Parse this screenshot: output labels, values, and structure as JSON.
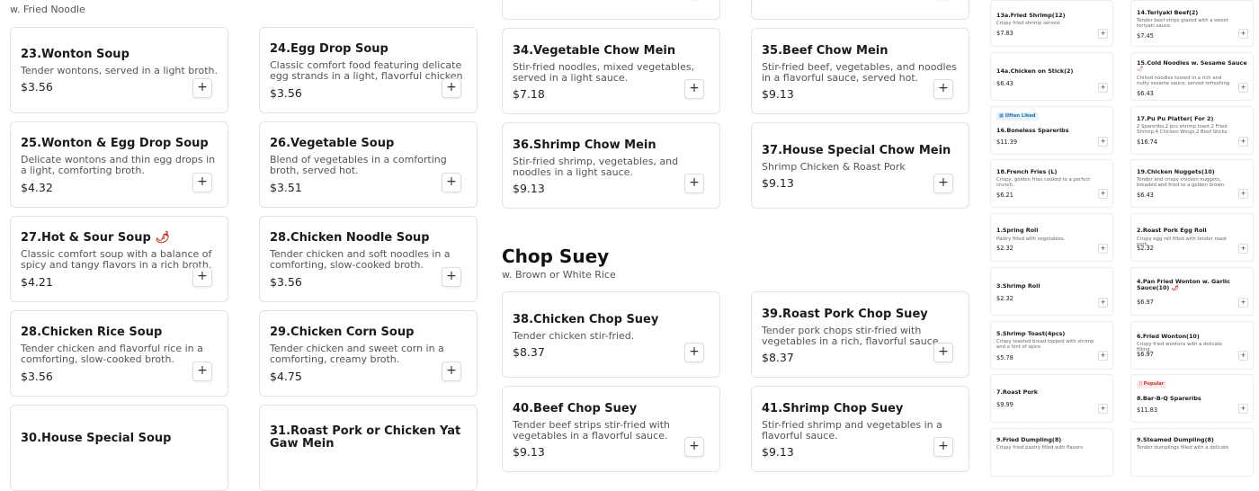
{
  "soups_subtitle": "w. Fried Noodle",
  "soups": [
    {
      "name": "23.Wonton Soup",
      "desc": "Tender wontons, served in a light broth.",
      "price": "$3.56"
    },
    {
      "name": "24.Egg Drop Soup",
      "desc": "Classic comfort food featuring delicate egg strands in a light, flavorful chicken broth.",
      "price": "$3.56"
    },
    {
      "name": "25.Wonton & Egg Drop Soup",
      "desc": "Delicate wontons and thin egg drops in a light, comforting broth.",
      "price": "$4.32"
    },
    {
      "name": "26.Vegetable Soup",
      "desc": "Blend of vegetables in a comforting broth, served hot.",
      "price": "$3.51"
    },
    {
      "name": "27.Hot & Sour Soup",
      "desc": "Classic comfort soup with a balance of spicy and tangy flavors in a rich broth.",
      "price": "$4.21"
    },
    {
      "name": "28.Chicken Noodle Soup",
      "desc": "Tender chicken and soft noodles in a comforting, slow-cooked broth.",
      "price": "$3.56"
    },
    {
      "name": "28.Chicken Rice Soup",
      "desc": "Tender chicken and flavorful rice in a comforting, slow-cooked broth.",
      "price": "$3.56"
    },
    {
      "name": "29.Chicken Corn Soup",
      "desc": "Tender chicken and sweet corn in a comforting, creamy broth.",
      "price": "$4.75"
    },
    {
      "name": "30.House Special Soup"
    },
    {
      "name": "31.Roast Pork or Chicken Yat Gaw Mein"
    }
  ],
  "chow_mein": [
    {
      "name": "34.Vegetable Chow Mein",
      "desc": "Stir-fried noodles, mixed vegetables, served in a light sauce.",
      "price": "$7.18"
    },
    {
      "name": "35.Beef Chow Mein",
      "desc": "Stir-fried beef, vegetables, and noodles in a flavorful sauce, served hot.",
      "price": "$9.13"
    },
    {
      "name": "36.Shrimp Chow Mein",
      "desc": "Stir-fried shrimp, vegetables, and noodles in a light sauce.",
      "price": "$9.13"
    },
    {
      "name": "37.House Special Chow Mein",
      "desc": "Shrimp Chicken & Roast Pork",
      "price": "$9.13"
    }
  ],
  "chop_suey_section": {
    "title": "Chop Suey",
    "subtitle": "w. Brown or White Rice"
  },
  "chop_suey": [
    {
      "name": "38.Chicken Chop Suey",
      "desc": "Tender chicken stir-fried.",
      "price": "$8.37"
    },
    {
      "name": "39.Roast Pork Chop Suey",
      "desc": "Tender pork chops stir-fried with vegetables in a rich, flavorful sauce.",
      "price": "$8.37"
    },
    {
      "name": "40.Beef Chop Suey",
      "desc": "Tender beef strips stir-fried with vegetables in a flavorful sauce.",
      "price": "$9.13"
    },
    {
      "name": "41.Shrimp Chop Suey",
      "desc": "Stir-fried shrimp and vegetables in a flavorful sauce.",
      "price": "$9.13"
    }
  ],
  "add_label": "+",
  "cart_items": [
    {
      "name": "13a.Fried Shrimp(12)",
      "desc": "Crispy fried shrimp served.",
      "price": "$7.83"
    },
    {
      "name": "14.Teriyaki Beef(2)",
      "desc": "Tender beef strips glazed with a sweet teriyaki sauce.",
      "price": "$7.45"
    },
    {
      "name": "14a.Chicken on Stick(2)",
      "price": "$6.43"
    },
    {
      "name": "15.Cold Noodles w. Sesame Sauce",
      "desc": "Chilled noodles tossed in a rich and nutty sesame sauce, served refreshing and l",
      "price": "$6.43"
    },
    {
      "badge": "Often Liked",
      "name": "16.Boneless Spareribs",
      "price": "$11.39"
    },
    {
      "name": "17.Pu Pu Platter( For 2)",
      "desc": "2 Spareribs,2 pcs shrimp toast,2 Fried Shrimp,4 Chicken Wings,2 Beef Sticks",
      "price": "$16.74"
    },
    {
      "name": "18.French Fries (L)",
      "desc": "Crispy, golden fries cooked to a perfect crunch.",
      "price": "$6.21"
    },
    {
      "name": "19.Chicken Nuggets(10)",
      "desc": "Tender and crispy chicken nuggets, breaded and fried to a golden brown perfection.",
      "price": "$6.43"
    },
    {
      "name": "1.Spring Roll",
      "desc": "Pastry filled with vegetables.",
      "price": "$2.32"
    },
    {
      "name": "2.Roast Pork Egg Roll",
      "desc": "Crispy egg roll filled with tender roast pork.",
      "price": "$2.32"
    },
    {
      "name": "3.Shrimp Roll",
      "price": "$2.32"
    },
    {
      "name": "4.Pan Fried Wonton w. Garlic Sauce(10)",
      "price": "$6.97"
    },
    {
      "name": "5.Shrimp Toast(4pcs)",
      "desc": "Crispy toasted bread topped with shrimp and a hint of spice",
      "price": "$5.78"
    },
    {
      "name": "6.Fried Wonton(10)",
      "desc": "Crispy fried wontons with a delicate filling.",
      "price": "$6.97"
    },
    {
      "name": "7.Roast Pork",
      "price": "$9.99"
    },
    {
      "badge": "Popular",
      "name": "8.Bar-B-Q Spareribs",
      "price": "$11.83"
    },
    {
      "name": "9.Fried Dumpling(8)",
      "desc": "Crispy fried pastry filled with flavors"
    },
    {
      "name": "9.Steamed Dumpling(8)",
      "desc": "Tender dumplings filled with a delicate"
    }
  ],
  "colors": {
    "accent_spicy": "#c0392b",
    "badge_often": "#1f6fa8",
    "badge_popular": "#c0392b"
  }
}
